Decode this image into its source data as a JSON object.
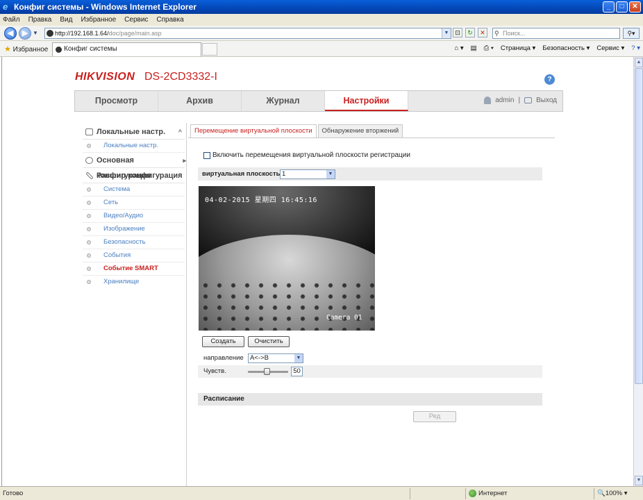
{
  "window": {
    "title": "Конфиг системы - Windows Internet Explorer",
    "ie_glyph": "e",
    "min": "_",
    "max": "□",
    "close": "✕"
  },
  "menu": [
    "Файл",
    "Правка",
    "Вид",
    "Избранное",
    "Сервис",
    "Справка"
  ],
  "address": {
    "url_host": "http://192.168.1.64/",
    "url_path": "doc/page/main.asp",
    "search_placeholder": "Поиск..."
  },
  "favorites": {
    "label": "Избранное",
    "tab_title": "Конфиг системы"
  },
  "commands": [
    "Страница ▾",
    "Безопасность ▾",
    "Сервис ▾"
  ],
  "brand": {
    "logo": "HIKVISION",
    "model": "DS-2CD3332-I",
    "help": "?"
  },
  "nav": {
    "tabs": [
      "Просмотр",
      "Архив",
      "Журнал",
      "Настройки"
    ],
    "active": "Настройки",
    "user": "admin",
    "sep": "|",
    "logout": "Выход"
  },
  "sidebar": {
    "local": {
      "title": "Локальные настр.",
      "items": [
        "Локальные настр."
      ]
    },
    "basic": {
      "title": "Основная конфигурация"
    },
    "advanced": {
      "title": "Расшир конфигурация",
      "items": [
        "Система",
        "Сеть",
        "Видео/Аудио",
        "Изображение",
        "Безопасность",
        "События",
        "Событие SMART",
        "Хранилище"
      ],
      "active": "Событие SMART"
    }
  },
  "content": {
    "tabs": [
      "Перемещение виртуальной плоскости",
      "Обнаружение вторжений"
    ],
    "enable_label": "Включить перемещения виртуальной плоскости регистрации",
    "plane_label": "виртуальная плоскость",
    "plane_value": "1",
    "osd_time": "04-02-2015 星期四 16:45:16",
    "camera_name": "Camera 01",
    "create_button": "Создать",
    "clear_button": "Очистить",
    "direction_label": "направление",
    "direction_value": "A<->B",
    "sensitivity_label": "Чувств.",
    "sensitivity_value": "50",
    "schedule_label": "Расписание",
    "edit_button": "Ред"
  },
  "status": {
    "left": "Готово",
    "zone": "Интернет",
    "zoom": "🔍100% ▾"
  },
  "colors": {
    "brand_red": "#c8201e",
    "link_blue": "#4a7fc1",
    "titlebar": "#0447b8"
  }
}
